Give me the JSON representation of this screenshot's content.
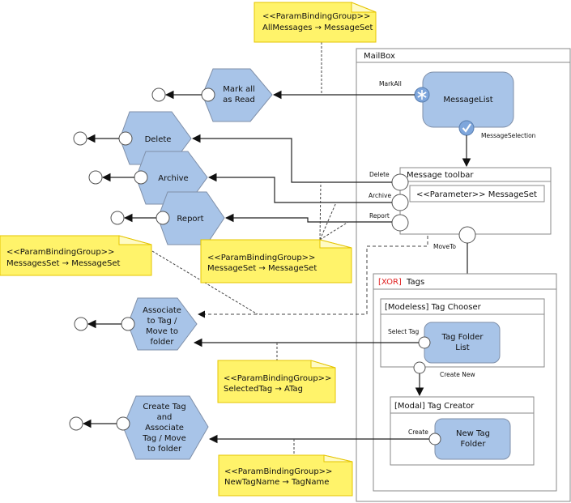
{
  "notes": {
    "top": {
      "line1": "<<ParamBindingGroup>>",
      "line2": "AllMessages → MessageSet"
    },
    "left": {
      "line1": "<<ParamBindingGroup>>",
      "line2": "MessagesSet → MessageSet"
    },
    "middle": {
      "line1": "<<ParamBindingGroup>>",
      "line2": "MessageSet → MessageSet"
    },
    "selected_tag": {
      "line1": "<<ParamBindingGroup>>",
      "line2": "SelectedTag → ATag"
    },
    "new_tag": {
      "line1": "<<ParamBindingGroup>>",
      "line2": "NewTagName → TagName"
    }
  },
  "mailbox": {
    "title": "MailBox",
    "message_list": {
      "label": "MessageList",
      "mark_all_event": "MarkAll",
      "selection_event": "MessageSelection",
      "mark_all_icon": "asterisk-icon",
      "selection_icon": "checkmark-icon"
    },
    "toolbar": {
      "title": "Message toolbar",
      "parameter": "<<Parameter>> MessageSet",
      "events": {
        "delete": "Delete",
        "archive": "Archive",
        "report": "Report",
        "move_to": "MoveTo"
      }
    },
    "tags": {
      "xor": "[XOR]",
      "title": "Tags",
      "chooser": {
        "title": "[Modeless] Tag Chooser",
        "list_line1": "Tag Folder",
        "list_line2": "List",
        "select_event": "Select Tag",
        "create_event": "Create New"
      },
      "creator": {
        "title": "[Modal] Tag Creator",
        "box_line1": "New Tag",
        "box_line2": "Folder",
        "create_event": "Create"
      }
    }
  },
  "actions": {
    "mark_all": [
      "Mark all",
      "as Read"
    ],
    "delete": [
      "Delete"
    ],
    "archive": [
      "Archive"
    ],
    "report": [
      "Report"
    ],
    "associate": [
      "Associate",
      "to Tag /",
      "Move to",
      "folder"
    ],
    "create_tag": [
      "Create Tag",
      "and",
      "Associate",
      "Tag / Move",
      "to folder"
    ]
  },
  "colors": {
    "node_fill": "#a8c4e8",
    "note_fill": "#fff36a",
    "xor_text": "#e02020"
  }
}
